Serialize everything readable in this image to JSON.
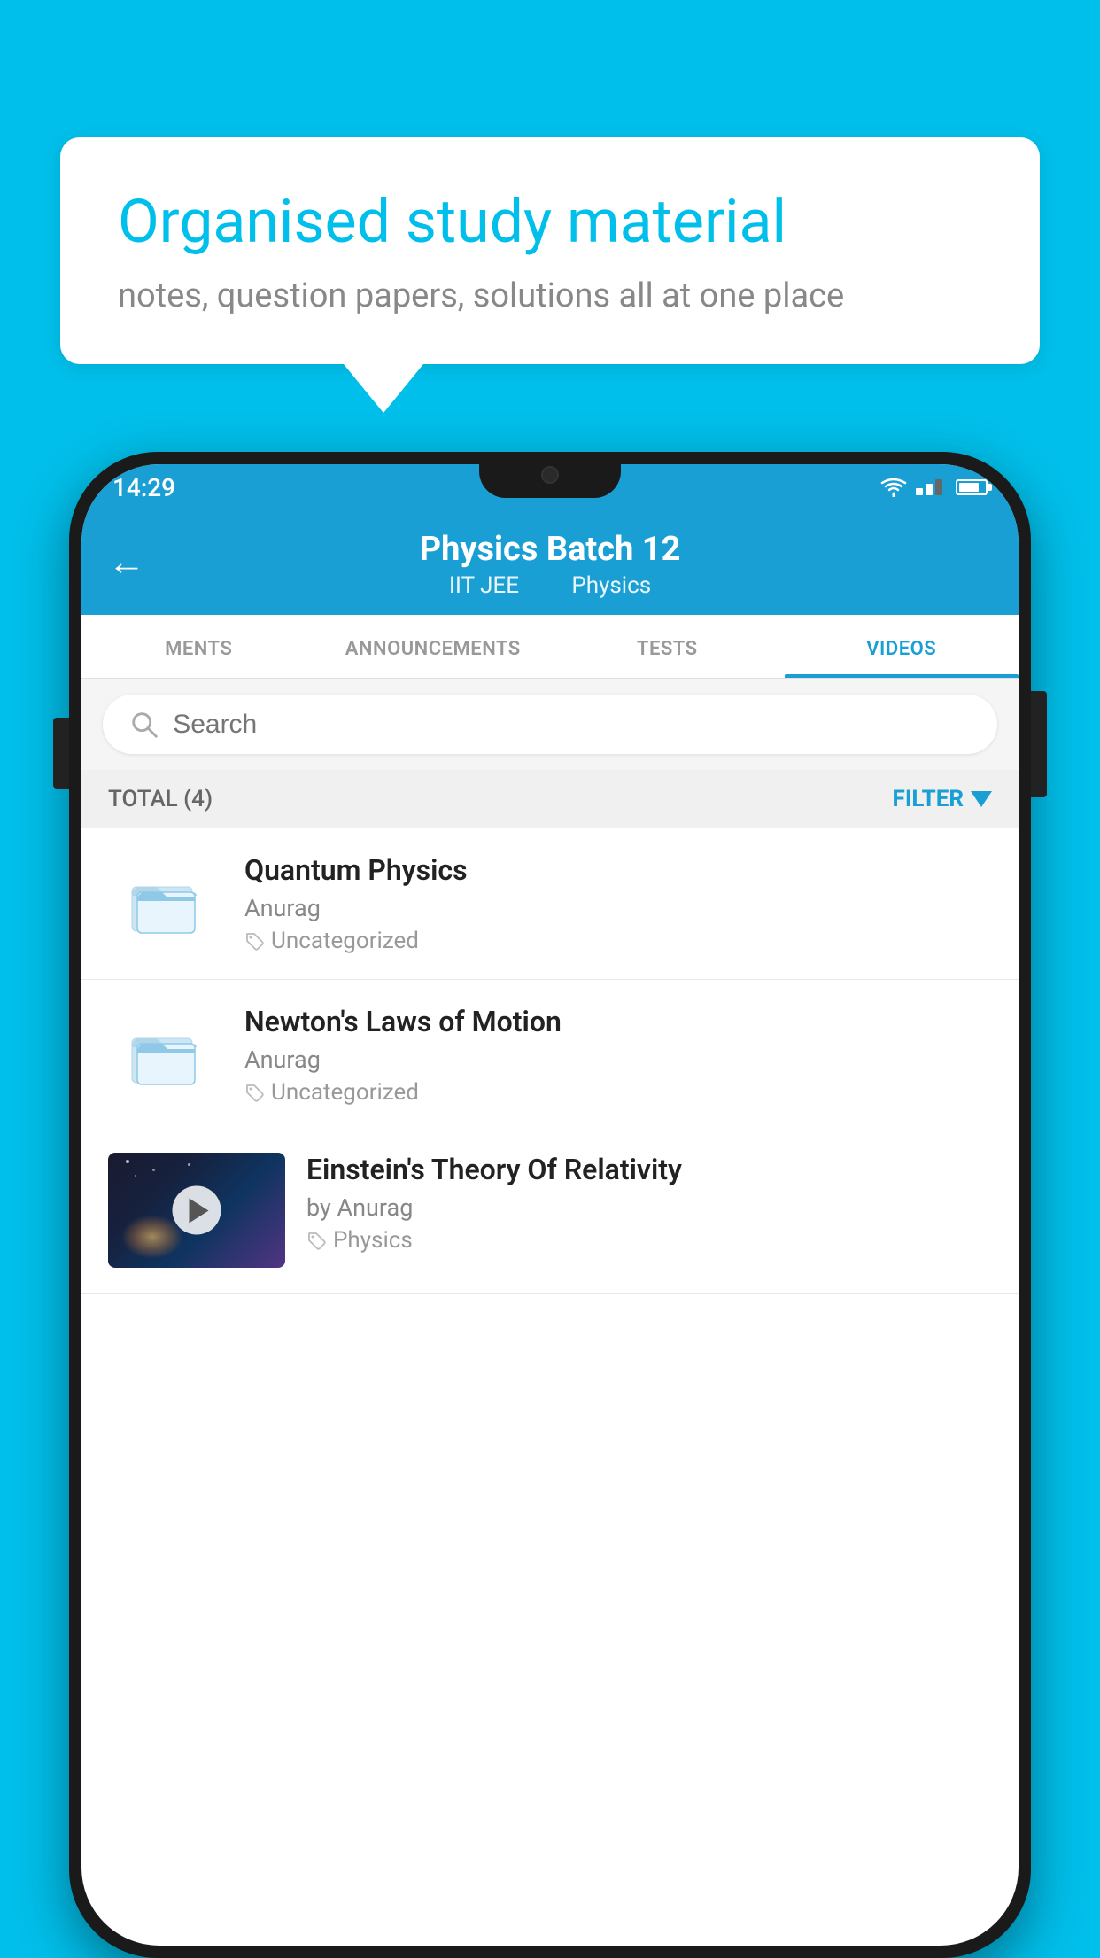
{
  "background_color": "#00BFEA",
  "speech_bubble": {
    "title": "Organised study material",
    "subtitle": "notes, question papers, solutions all at one place"
  },
  "status_bar": {
    "time": "14:29"
  },
  "header": {
    "title": "Physics Batch 12",
    "subtitle_left": "IIT JEE",
    "subtitle_right": "Physics",
    "back_label": "←"
  },
  "tabs": [
    {
      "label": "MENTS",
      "active": false
    },
    {
      "label": "ANNOUNCEMENTS",
      "active": false
    },
    {
      "label": "TESTS",
      "active": false
    },
    {
      "label": "VIDEOS",
      "active": true
    }
  ],
  "search": {
    "placeholder": "Search"
  },
  "filter_bar": {
    "total_label": "TOTAL (4)",
    "filter_label": "FILTER"
  },
  "videos": [
    {
      "title": "Quantum Physics",
      "author": "Anurag",
      "tag": "Uncategorized",
      "has_thumb": false
    },
    {
      "title": "Newton's Laws of Motion",
      "author": "Anurag",
      "tag": "Uncategorized",
      "has_thumb": false
    },
    {
      "title": "Einstein's Theory Of Relativity",
      "author": "by Anurag",
      "tag": "Physics",
      "has_thumb": true
    }
  ]
}
